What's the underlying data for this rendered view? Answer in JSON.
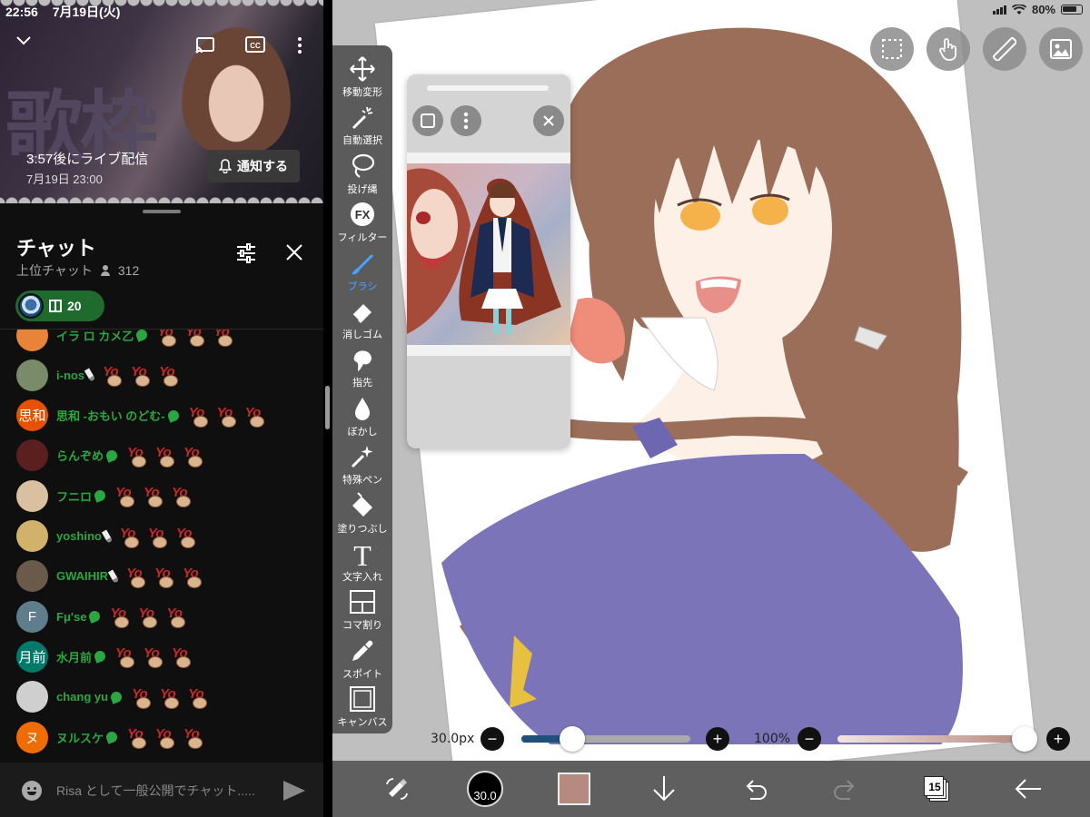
{
  "status_bar": {
    "time": "22:56",
    "date": "7月19日(火)",
    "battery": "80%"
  },
  "video": {
    "banner_text": "歌枠",
    "countdown": "3:57後にライブ配信",
    "scheduled": "7月19日 23:00",
    "notify_label": "通知する",
    "icons": [
      "chevron-down-icon",
      "cast-icon",
      "captions-icon",
      "more-vert-icon",
      "bell-icon"
    ]
  },
  "chat": {
    "title": "チャット",
    "mode": "上位チャット",
    "viewers": "312",
    "gift_count": "20",
    "input_placeholder": "Risa として一般公開でチャット.....",
    "messages": [
      {
        "author": "イラ ロ カメ乙",
        "initials": "",
        "avatar_color": "#e8833a",
        "badge": "member",
        "emotes": 3
      },
      {
        "author": "i-nos",
        "initials": "",
        "avatar_color": "#7a8b6a",
        "badge": "pen",
        "emotes": 3
      },
      {
        "author": "思和 -おもい のどむ-",
        "initials": "思和",
        "avatar_color": "#e65100",
        "badge": "member",
        "emotes": 3
      },
      {
        "author": "らんぞめ",
        "initials": "",
        "avatar_color": "#5a1f1f",
        "badge": "member",
        "emotes": 3
      },
      {
        "author": "フニロ",
        "initials": "",
        "avatar_color": "#d8c0a0",
        "badge": "member",
        "emotes": 3
      },
      {
        "author": "yoshino",
        "initials": "",
        "avatar_color": "#d2b26a",
        "badge": "pen",
        "emotes": 3
      },
      {
        "author": "GWAIHIR",
        "initials": "",
        "avatar_color": "#6a5a4a",
        "badge": "pen",
        "emotes": 3
      },
      {
        "author": "Fμ'se",
        "initials": "F",
        "avatar_color": "#607d8b",
        "badge": "member",
        "emotes": 3
      },
      {
        "author": "水月前",
        "initials": "月前",
        "avatar_color": "#00796b",
        "badge": "member",
        "emotes": 3
      },
      {
        "author": "chang yu",
        "initials": "",
        "avatar_color": "#cfcfcf",
        "badge": "member",
        "emotes": 3
      },
      {
        "author": "ヌルスケ",
        "initials": "ヌ",
        "avatar_color": "#ef6c00",
        "badge": "member",
        "emotes": 3
      }
    ]
  },
  "drawing_app": {
    "tools": [
      {
        "label": "移動変形",
        "icon": "move-icon",
        "active": false
      },
      {
        "label": "自動選択",
        "icon": "magic-wand-icon",
        "active": false
      },
      {
        "label": "投げ縄",
        "icon": "lasso-icon",
        "active": false
      },
      {
        "label": "フィルター",
        "icon": "fx-icon",
        "active": false
      },
      {
        "label": "ブラシ",
        "icon": "brush-icon",
        "active": true
      },
      {
        "label": "消しゴム",
        "icon": "eraser-icon",
        "active": false
      },
      {
        "label": "指先",
        "icon": "smudge-icon",
        "active": false
      },
      {
        "label": "ぼかし",
        "icon": "blur-icon",
        "active": false
      },
      {
        "label": "特殊ペン",
        "icon": "special-pen-icon",
        "active": false
      },
      {
        "label": "塗りつぶし",
        "icon": "fill-icon",
        "active": false
      },
      {
        "label": "文字入れ",
        "icon": "text-icon",
        "active": false
      },
      {
        "label": "コマ割り",
        "icon": "frame-divider-icon",
        "active": false
      },
      {
        "label": "スポイト",
        "icon": "eyedropper-icon",
        "active": false
      },
      {
        "label": "キャンバス",
        "icon": "canvas-icon",
        "active": false
      }
    ],
    "brush_size_label": "30.0px",
    "brush_size_fraction": 0.3,
    "opacity_label": "100%",
    "opacity_fraction": 1.0,
    "brush_size_badge": "30.0",
    "layer_count": "15",
    "current_color": "#b58a80",
    "fx_text": "FX",
    "text_tool_glyph": "T"
  }
}
